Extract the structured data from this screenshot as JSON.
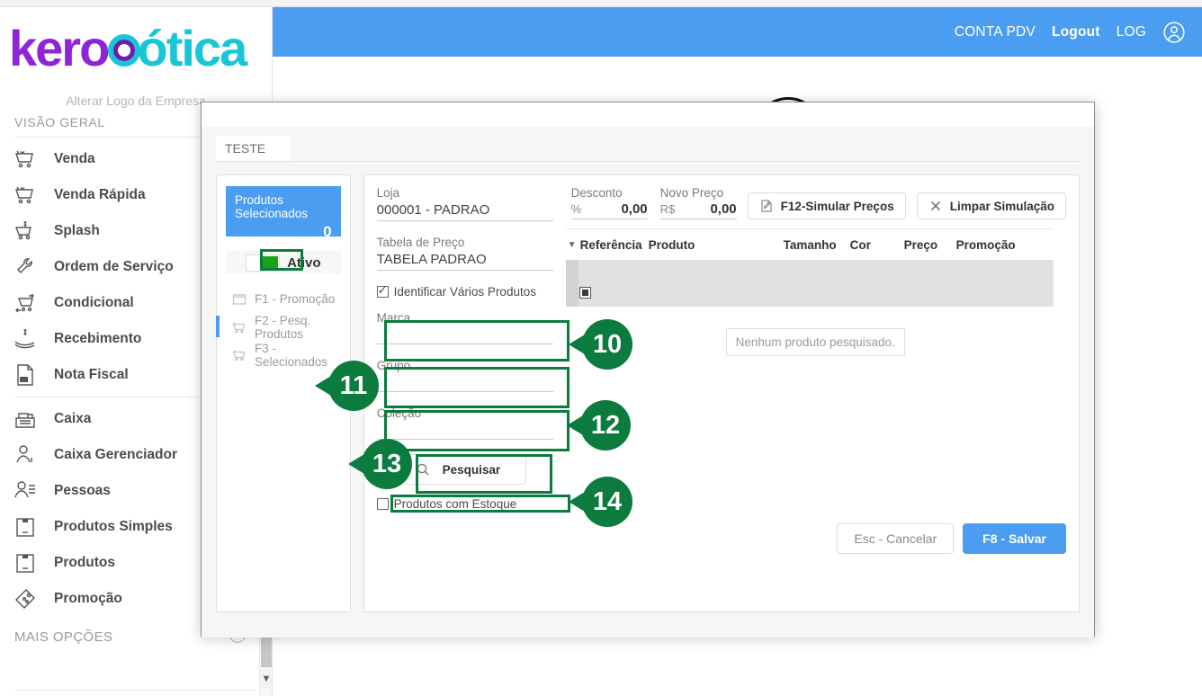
{
  "header": {
    "account_label": "CONTA PDV",
    "logout_label": "Logout",
    "log_label": "LOG",
    "avatar_icon": "user-circle-icon",
    "accent_color": "#4a9df0"
  },
  "sidebar": {
    "logo_part1": "kero",
    "logo_part2": "ótica",
    "logo_color_1": "#8e24d6",
    "logo_color_2": "#19c6d6",
    "change_logo_label": "Alterar Logo da Empresa",
    "section_title": "VISÃO GERAL",
    "items": [
      {
        "label": "Venda",
        "icon": "cart-icon"
      },
      {
        "label": "Venda Rápida",
        "icon": "cart-fast-icon"
      },
      {
        "label": "Splash",
        "icon": "cart-dollar-icon"
      },
      {
        "label": "Ordem de Serviço",
        "icon": "wrench-icon"
      },
      {
        "label": "Condicional",
        "icon": "cart-arrow-icon"
      },
      {
        "label": "Recebimento",
        "icon": "hand-money-icon"
      },
      {
        "label": "Nota Fiscal",
        "icon": "nfe-document-icon"
      },
      {
        "label": "Caixa",
        "icon": "cash-register-icon"
      },
      {
        "label": "Caixa Gerenciador",
        "icon": "user-dollar-icon"
      },
      {
        "label": "Pessoas",
        "icon": "user-list-icon"
      },
      {
        "label": "Produtos Simples",
        "icon": "box-icon"
      },
      {
        "label": "Produtos",
        "icon": "box-icon"
      },
      {
        "label": "Promoção",
        "icon": "price-tag-icon"
      }
    ],
    "more_options_label": "MAIS OPÇÕES",
    "more_options_icon": "chevron-down-circle-icon",
    "scroll_down_icon": "chevron-down-icon"
  },
  "modal": {
    "tab_label": "TESTE",
    "left_panel": {
      "selected_title": "Produtos Selecionados",
      "selected_count": "0",
      "toggle_label": "Ativo",
      "toggle_state": "on",
      "links": [
        {
          "label": "F1 - Promoção",
          "icon": "tag-outline-icon",
          "active": false
        },
        {
          "label": "F2 - Pesq. Produtos",
          "icon": "cart-icon",
          "active": true
        },
        {
          "label": "F3 - Selecionados",
          "icon": "cart-icon",
          "active": false
        }
      ]
    },
    "form": {
      "loja_label": "Loja",
      "loja_value": "000001 - PADRAO",
      "tabela_label": "Tabela de Preço",
      "tabela_value": "TABELA PADRAO",
      "identificar_label": "Identificar Vários Produtos",
      "identificar_checked": true,
      "marca_label": "Marca",
      "marca_value": "",
      "grupo_label": "Grupo",
      "grupo_value": "",
      "colecao_label": "Coleção",
      "colecao_value": "",
      "pesquisar_label": "Pesquisar",
      "pesquisar_icon": "search-icon",
      "estoque_label": "Produtos com Estoque",
      "estoque_checked": false
    },
    "pricing": {
      "desconto_label": "Desconto",
      "desconto_unit": "%",
      "desconto_value": "0,00",
      "novo_preco_label": "Novo Preço",
      "novo_preco_unit": "R$",
      "novo_preco_value": "0,00",
      "simular_label": "F12-Simular Preços",
      "simular_icon": "edit-document-icon",
      "limpar_label": "Limpar Simulação",
      "limpar_icon": "close-x-icon"
    },
    "table": {
      "sort_icon": "caret-down-icon",
      "columns": [
        "Referência",
        "Produto",
        "Tamanho",
        "Cor",
        "Preço",
        "Promoção"
      ],
      "rows": [],
      "empty_message": "Nenhum produto pesquisado."
    },
    "footer": {
      "cancel_label": "Esc - Cancelar",
      "save_label": "F8 - Salvar"
    }
  },
  "annotations": {
    "color": "#0b7b3e",
    "pins": [
      {
        "number": "10",
        "target": "marca-field"
      },
      {
        "number": "11",
        "target": "grupo-field"
      },
      {
        "number": "12",
        "target": "colecao-field"
      },
      {
        "number": "13",
        "target": "pesquisar-button"
      },
      {
        "number": "14",
        "target": "produtos-com-estoque-checkbox"
      }
    ]
  }
}
